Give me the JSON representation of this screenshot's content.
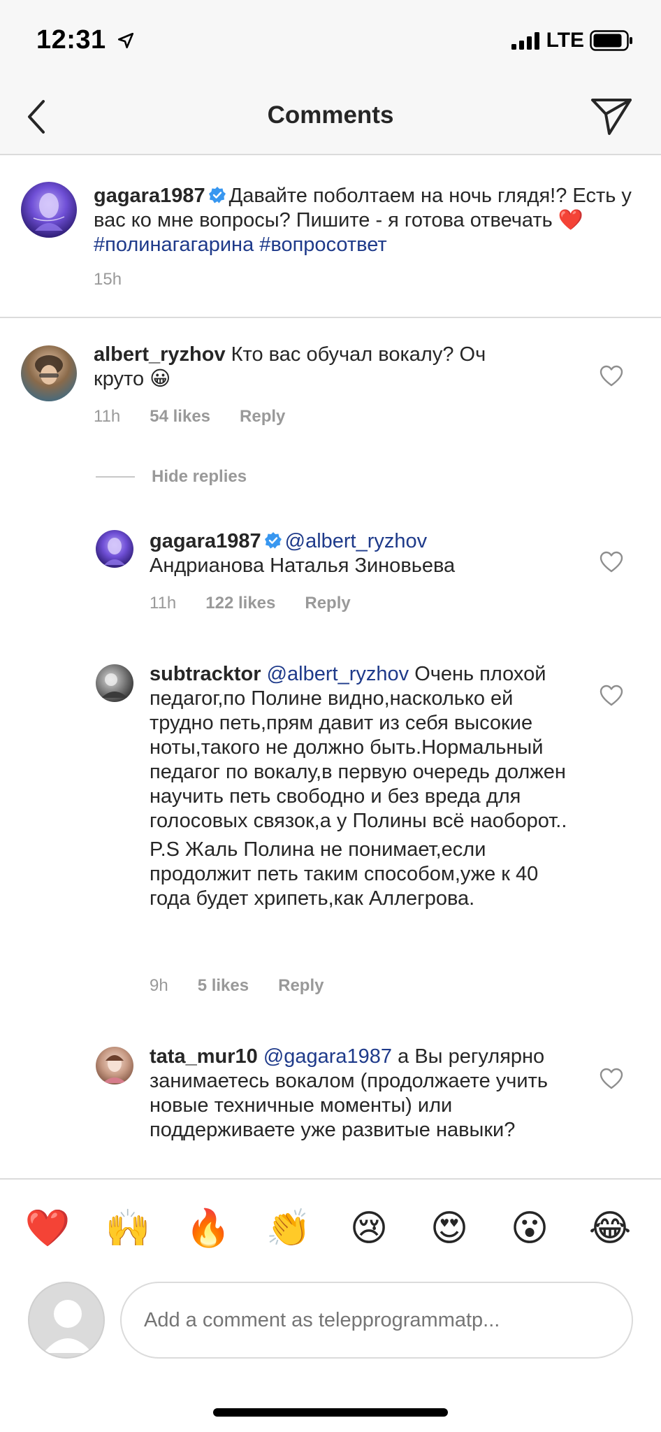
{
  "status_bar": {
    "time": "12:31",
    "network": "LTE"
  },
  "nav": {
    "title": "Comments"
  },
  "caption": {
    "username": "gagara1987",
    "text_parts": [
      "Давайте поболтаем на ночь глядя!? Есть у вас ко мне вопросы? Пишите - я готова отвечать ",
      "❤️",
      " "
    ],
    "hashtags": [
      "#полинагагарина",
      "#вопросответ"
    ],
    "time": "15h"
  },
  "comments": [
    {
      "username": "albert_ryzhov",
      "text": "Кто вас обучал вокалу? Оч круто 😀",
      "time": "11h",
      "likes": "54 likes",
      "reply": "Reply"
    }
  ],
  "hide_replies": "Hide replies",
  "replies": [
    {
      "username": "gagara1987",
      "mention": "@albert_ryzhov",
      "text": "Андрианова Наталья Зиновьева",
      "time": "11h",
      "likes": "122 likes",
      "reply": "Reply"
    },
    {
      "username": "subtracktor",
      "mention": "@albert_ryzhov",
      "text": "Очень плохой педагог,по Полине видно,насколько ей трудно петь,прям давит из себя высокие ноты,такого не должно быть.Нормальный педагог по вокалу,в первую очередь должен научить петь свободно и без вреда для голосовых связок,а у Полины всё наоборот..",
      "text2": "P.S Жаль Полина не понимает,если продолжит петь таким способом,уже к 40 года будет хрипеть,как Аллегрова.",
      "time": "9h",
      "likes": "5 likes",
      "reply": "Reply"
    },
    {
      "username": "tata_mur10",
      "mention": "@gagara1987",
      "text": "а Вы регулярно занимаетесь вокалом (продолжаете учить новые техничные моменты) или поддерживаете уже развитые навыки?"
    }
  ],
  "emoji_bar": [
    "❤️",
    "🙌",
    "🔥",
    "👏",
    "😢",
    "😍",
    "😮",
    "😂"
  ],
  "input": {
    "placeholder": "Add a comment as telepprogrammatp..."
  },
  "colors": {
    "link": "#1e3a8a",
    "meta": "#999999",
    "verified": "#3897f0",
    "heart_red": "#ed4956"
  }
}
